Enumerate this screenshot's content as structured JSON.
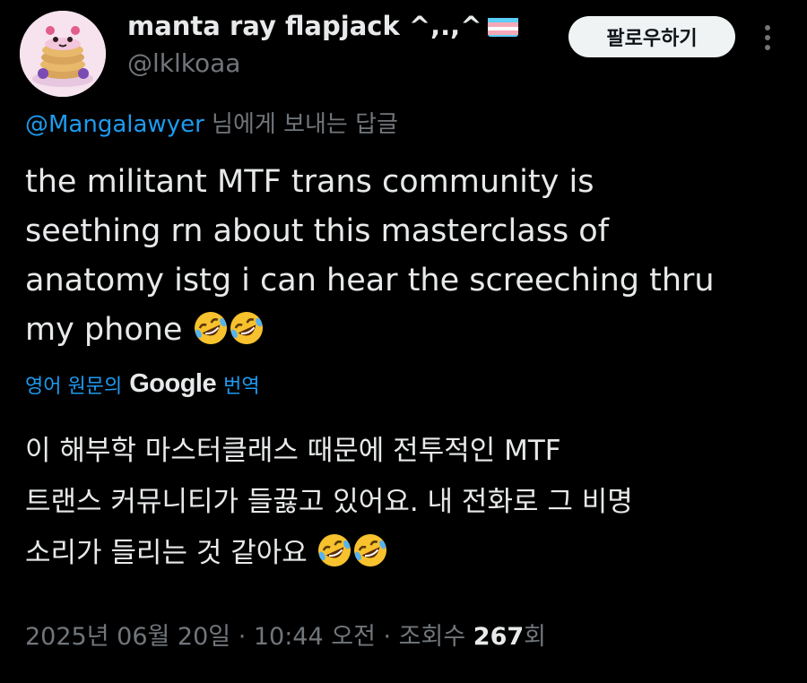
{
  "author": {
    "display_name": "manta ray flapjack ^,.,^",
    "handle": "@lklkoaa",
    "flag_icon": "transgender-flag-icon",
    "avatar_icon": "pancake-stack-avatar"
  },
  "actions": {
    "follow_label": "팔로우하기",
    "more_icon": "more-vertical-icon"
  },
  "reply": {
    "mention": "@Mangalawyer",
    "suffix": " 님에게 보내는 답글"
  },
  "tweet": {
    "text": "the militant MTF trans community is\nseething rn about this masterclass of\nanatomy istg i can hear the screeching thru\nmy phone ",
    "emoji": "rolling-on-floor-laughing-emoji"
  },
  "translation": {
    "prefix": "영어 원문의",
    "brand": "Google",
    "suffix": "번역",
    "text": "이 해부학 마스터클래스 때문에 전투적인 MTF\n트랜스 커뮤니티가 들끓고 있어요. 내 전화로 그 비명\n소리가 들리는 것 같아요 "
  },
  "meta": {
    "timestamp": "2025년 06월 20일 · 10:44 오전 · 조회수 ",
    "views": "267",
    "views_suffix": "회"
  },
  "colors": {
    "background": "#000000",
    "text_primary": "#e7e9ea",
    "text_secondary": "#71767b",
    "accent": "#1d9bf0",
    "button_bg": "#eff3f4"
  }
}
